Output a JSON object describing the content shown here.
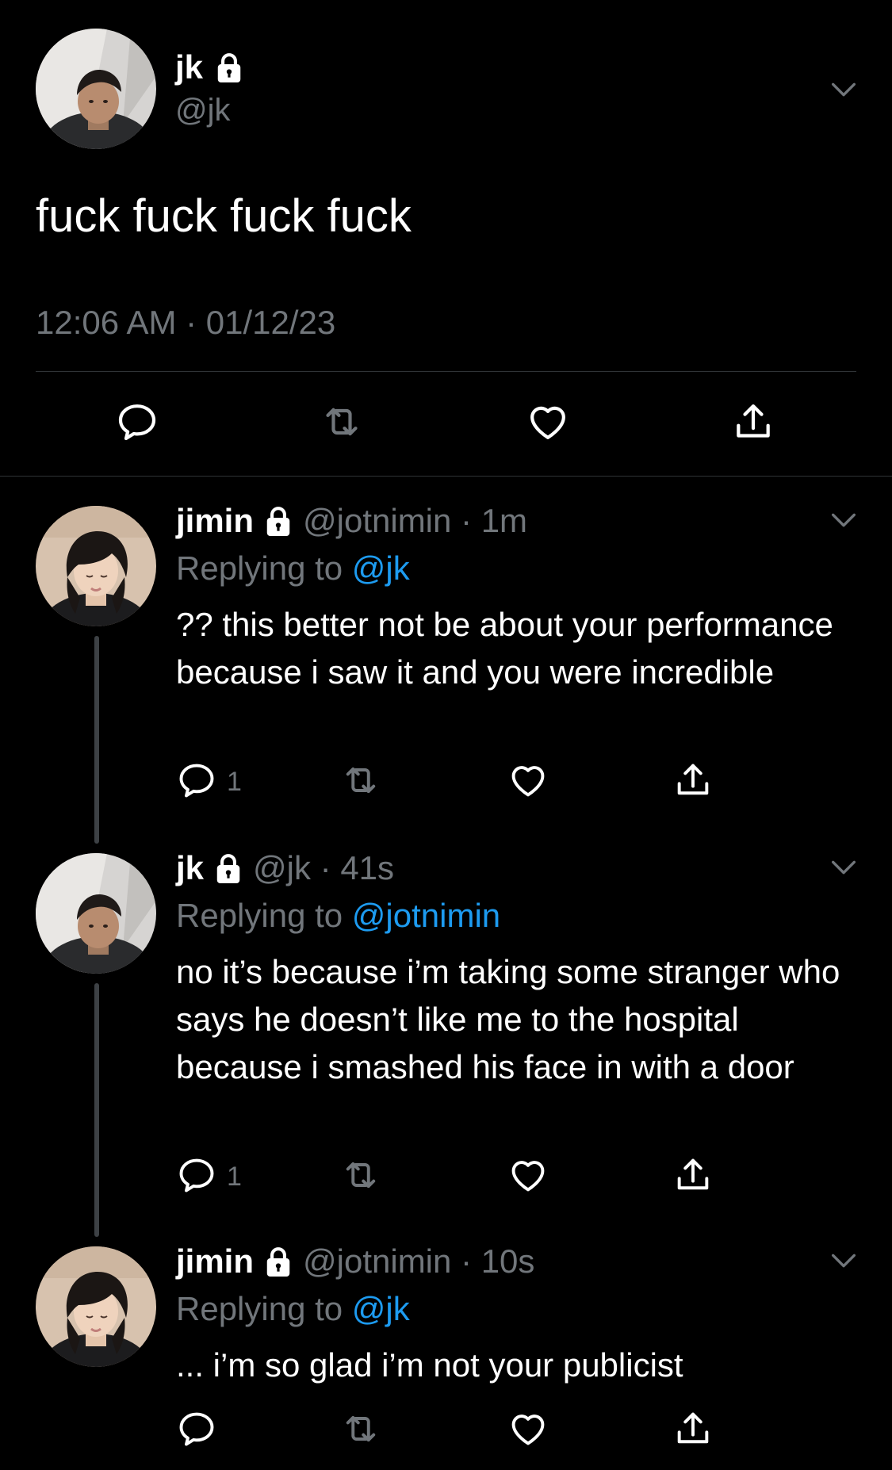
{
  "main_tweet": {
    "display_name": "jk",
    "handle": "@jk",
    "text": "fuck fuck fuck fuck",
    "timestamp": "12:06 AM · 01/12/23",
    "icons": [
      "lock-icon",
      "chevron-down-icon",
      "reply-icon",
      "retweet-icon",
      "like-icon",
      "share-icon"
    ]
  },
  "replies": [
    {
      "display_name": "jimin",
      "handle_time": "@jotnimin · 1m",
      "replying_prefix": "Replying to",
      "replying_to": "@jk",
      "text": "?? this better not be about your performance because i saw it and you were incredible",
      "reply_count": "1"
    },
    {
      "display_name": "jk",
      "handle_time": "@jk · 41s",
      "replying_prefix": "Replying to",
      "replying_to": "@jotnimin",
      "text": "no it’s because i’m taking some stranger who says he doesn’t like me to the hospital because i smashed his face in with a door",
      "reply_count": "1"
    },
    {
      "display_name": "jimin",
      "handle_time": "@jotnimin · 10s",
      "replying_prefix": "Replying to",
      "replying_to": "@jk",
      "text": "... i’m so glad i’m not your publicist",
      "reply_count": ""
    }
  ],
  "colors": {
    "background": "#000000",
    "text": "#ffffff",
    "secondary": "#71767b",
    "link": "#1d9bf0",
    "divider": "#2f3336",
    "thread_line": "#3d4145"
  }
}
